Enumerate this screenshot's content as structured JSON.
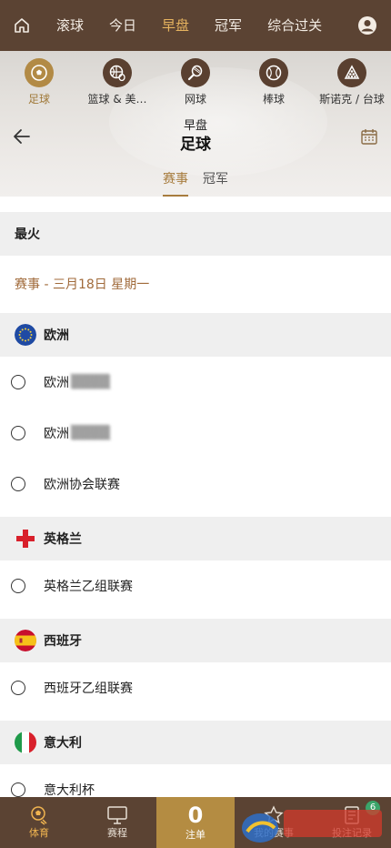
{
  "topnav": {
    "tabs": [
      {
        "label": "滚球",
        "active": false
      },
      {
        "label": "今日",
        "active": false
      },
      {
        "label": "早盘",
        "active": true
      },
      {
        "label": "冠军",
        "active": false
      },
      {
        "label": "综合过关",
        "active": false
      }
    ]
  },
  "sports": [
    {
      "label": "足球",
      "icon": "soccer-icon",
      "active": true
    },
    {
      "label": "篮球 & 美…",
      "icon": "basketball-icon",
      "active": false
    },
    {
      "label": "网球",
      "icon": "tennis-icon",
      "active": false
    },
    {
      "label": "棒球",
      "icon": "baseball-icon",
      "active": false
    },
    {
      "label": "斯诺克 / 台球",
      "icon": "snooker-icon",
      "active": false
    }
  ],
  "header": {
    "subtitle": "早盘",
    "title": "足球"
  },
  "subtabs": [
    {
      "label": "赛事",
      "active": true
    },
    {
      "label": "冠军",
      "active": false
    }
  ],
  "list": {
    "hot_label": "最火",
    "date_label": "赛事 - 三月18日 星期一",
    "regions": [
      {
        "name": "欧洲",
        "leagues": [
          "欧洲",
          "欧洲",
          "欧洲协会联赛"
        ]
      },
      {
        "name": "英格兰",
        "leagues": [
          "英格兰乙组联赛"
        ]
      },
      {
        "name": "西班牙",
        "leagues": [
          "西班牙乙组联赛"
        ]
      },
      {
        "name": "意大利",
        "leagues": [
          "意大利杯"
        ]
      }
    ]
  },
  "bottombar": {
    "items": [
      {
        "label": "体育",
        "icon": "sports-icon",
        "active": true
      },
      {
        "label": "赛程",
        "icon": "monitor-icon",
        "active": false
      },
      {
        "label": "注单",
        "count": "0",
        "active": false
      },
      {
        "label": "我的赛事",
        "icon": "star-icon",
        "active": false
      },
      {
        "label": "投注记录",
        "icon": "record-icon",
        "badge": "6",
        "active": false
      }
    ]
  },
  "colors": {
    "brand": "#5b4333",
    "accent": "#b48c42",
    "date_text": "#a06a3a"
  }
}
